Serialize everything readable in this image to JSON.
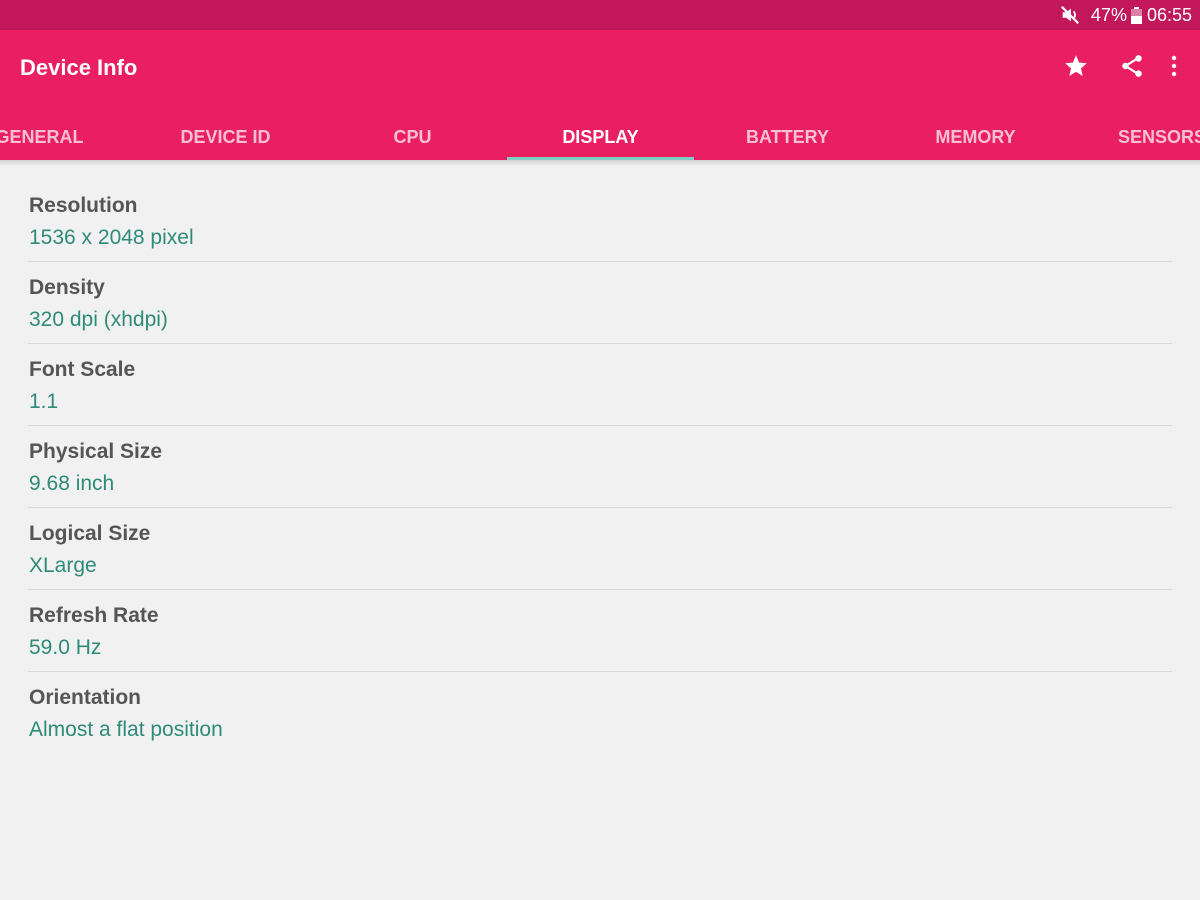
{
  "status": {
    "battery": "47%",
    "time": "06:55"
  },
  "app": {
    "title": "Device Info"
  },
  "tabs": [
    {
      "label": "GENERAL"
    },
    {
      "label": "DEVICE ID"
    },
    {
      "label": "CPU"
    },
    {
      "label": "DISPLAY",
      "active": true
    },
    {
      "label": "BATTERY"
    },
    {
      "label": "MEMORY"
    },
    {
      "label": "SENSORS"
    }
  ],
  "colors": {
    "status_bar": "#c2185b",
    "app_bar": "#e91e63",
    "indicator": "#7fcfc0",
    "label": "#555555",
    "value": "#2e8b78"
  },
  "display": {
    "items": [
      {
        "label": "Resolution",
        "value": "1536 x 2048 pixel"
      },
      {
        "label": "Density",
        "value": "320 dpi (xhdpi)"
      },
      {
        "label": "Font Scale",
        "value": "1.1"
      },
      {
        "label": "Physical Size",
        "value": "9.68 inch"
      },
      {
        "label": "Logical Size",
        "value": "XLarge"
      },
      {
        "label": "Refresh Rate",
        "value": "59.0 Hz"
      },
      {
        "label": "Orientation",
        "value": "Almost a flat position"
      }
    ]
  }
}
